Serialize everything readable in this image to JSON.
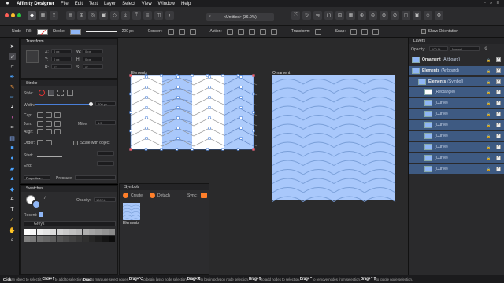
{
  "menubar": {
    "app_name": "Affinity Designer",
    "items": [
      "File",
      "Edit",
      "Text",
      "Layer",
      "Select",
      "View",
      "Window",
      "Help"
    ]
  },
  "document": {
    "title": "<Untitled> (36.0%)",
    "close_glyph": "×"
  },
  "context": {
    "node_label": "Node",
    "fill_label": "Fill:",
    "stroke_label": "Stroke:",
    "stroke_width": "200 px",
    "convert_label": "Convert:",
    "action_label": "Action:",
    "transform_label": "Transform:",
    "snap_label": "Snap:",
    "show_orientation": "Show Orientation"
  },
  "transform_panel": {
    "title": "Transform",
    "x_label": "X:",
    "x_value": "0 px",
    "y_label": "Y:",
    "y_value": "0 px",
    "w_label": "W:",
    "w_value": "0 px",
    "h_label": "H:",
    "h_value": "0 px",
    "r_label": "R:",
    "r_value": "0°",
    "s_label": "S:",
    "s_value": "0°"
  },
  "stroke_panel": {
    "title": "Stroke",
    "style_label": "Style:",
    "width_label": "Width:",
    "width_value": "200 px",
    "cap_label": "Cap:",
    "join_label": "Join:",
    "align_label": "Align:",
    "mitre_label": "Mitre:",
    "mitre_value": "1.5",
    "order_label": "Order:",
    "scale_with_object": "Scale with object",
    "start_label": "Start:",
    "end_label": "End:",
    "properties_label": "Properties...",
    "pressure_label": "Pressure:"
  },
  "swatches_panel": {
    "title": "Swatches",
    "opacity_label": "Opacity:",
    "opacity_value": "100 %",
    "recent_label": "Recent:",
    "palette_name": "Greys"
  },
  "symbols_panel": {
    "title": "Symbols",
    "create_label": "Create",
    "detach_label": "Detach",
    "sync_label": "Sync:",
    "symbol_name": "Elements"
  },
  "canvas": {
    "artboard_left_label": "Elements",
    "artboard_right_label": "Ornament",
    "pattern_fill": "#a9c8fb",
    "pattern_stroke": "#7a9fd8"
  },
  "layers_panel": {
    "title": "Layers",
    "opacity_label": "Opacity:",
    "opacity_value": "100 %",
    "blend_mode": "Normal",
    "rows": [
      {
        "name": "Ornament",
        "kind": "(Artboard)"
      },
      {
        "name": "Elements",
        "kind": "(Artboard)"
      },
      {
        "name": "Elements",
        "kind": "(Symbol)"
      },
      {
        "name": "",
        "kind": "(Rectangle)"
      },
      {
        "name": "",
        "kind": "(Curve)"
      },
      {
        "name": "",
        "kind": "(Curve)"
      },
      {
        "name": "",
        "kind": "(Curve)"
      },
      {
        "name": "",
        "kind": "(Curve)"
      },
      {
        "name": "",
        "kind": "(Curve)"
      },
      {
        "name": "",
        "kind": "(Curve)"
      },
      {
        "name": "",
        "kind": "(Curve)"
      }
    ]
  },
  "status": {
    "segments": [
      {
        "text": "Click",
        "bold": true
      },
      {
        "text": " an object to select it. ",
        "bold": false
      },
      {
        "text": "Click+⇧",
        "bold": true
      },
      {
        "text": " to add to selection. ",
        "bold": false
      },
      {
        "text": "Drag",
        "bold": true
      },
      {
        "text": " to marquee select nodes. ",
        "bold": false
      },
      {
        "text": "Drag+⌥",
        "bold": true
      },
      {
        "text": " to begin lasso node selection. ",
        "bold": false
      },
      {
        "text": "Drag+⌘",
        "bold": true
      },
      {
        "text": " to begin polygon node selection. ",
        "bold": false
      },
      {
        "text": "Drag+⇧",
        "bold": true
      },
      {
        "text": " to add nodes to selection. ",
        "bold": false
      },
      {
        "text": "Drag+⌃",
        "bold": true
      },
      {
        "text": " to remove nodes from selection. ",
        "bold": false
      },
      {
        "text": "Drag+⌃⇧",
        "bold": true
      },
      {
        "text": " to toggle node selection.",
        "bold": false
      }
    ]
  },
  "colors": {
    "accent": "#3e5a82",
    "ui_dark": "#2c2c2e"
  }
}
